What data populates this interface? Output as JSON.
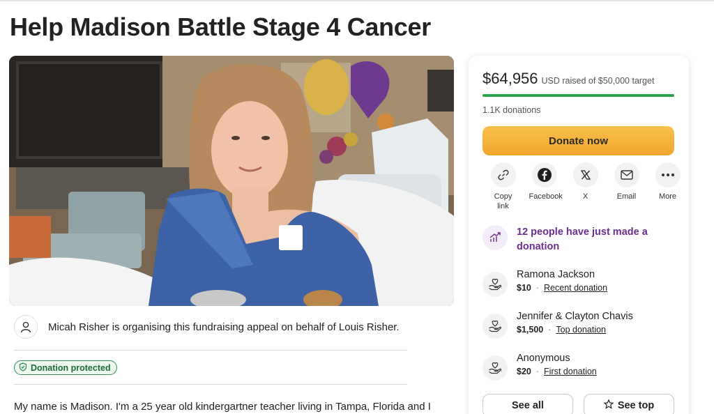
{
  "page": {
    "title": "Help Madison Battle Stage 4 Cancer"
  },
  "organiser": {
    "text": "Micah Risher is organising this fundraising appeal on behalf of Louis Risher.",
    "icon": "person-icon"
  },
  "badge": {
    "label": "Donation protected",
    "icon": "shield-icon",
    "color": "#2e8b57"
  },
  "story": {
    "first_line": "My name is Madison. I'm a 25 year old kindergartner teacher living in Tampa, Florida and I"
  },
  "card": {
    "raised_amount": "$64,956",
    "raised_text": "USD raised of $50,000 target",
    "progress_fraction": 1.0,
    "progress_color": "#2ba24c",
    "donations": "1.1K donations",
    "donate_label": "Donate now",
    "donate_color": "#f4b23c",
    "share": [
      {
        "label": "Copy link",
        "icon": "link-icon"
      },
      {
        "label": "Facebook",
        "icon": "facebook-icon"
      },
      {
        "label": "X",
        "icon": "x-icon"
      },
      {
        "label": "Email",
        "icon": "email-icon"
      },
      {
        "label": "More",
        "icon": "more-icon"
      }
    ],
    "activity": {
      "text": "12 people have just made a donation",
      "icon": "trending-up-icon",
      "color": "#6b2d8f"
    },
    "donors": [
      {
        "name": "Ramona Jackson",
        "amount": "$10",
        "tag": "Recent donation"
      },
      {
        "name": "Jennifer & Clayton Chavis",
        "amount": "$1,500",
        "tag": "Top donation"
      },
      {
        "name": "Anonymous",
        "amount": "$20",
        "tag": "First donation"
      }
    ],
    "see_all_label": "See all",
    "see_top_label": "See top"
  }
}
